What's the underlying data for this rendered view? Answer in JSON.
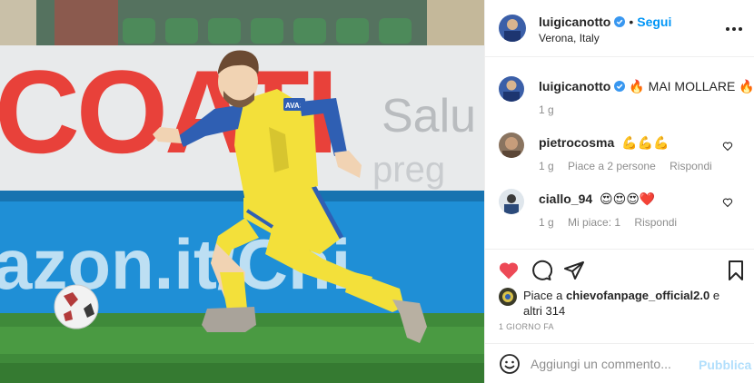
{
  "post": {
    "username": "luigicanotto",
    "follow_label": "Segui",
    "separator": "•",
    "location": "Verona, Italy",
    "caption": "MAI MOLLARE",
    "caption_emoji_before": "🔥",
    "caption_emoji_after": "🔥",
    "caption_time": "1 g"
  },
  "photo": {
    "banner_top_text": "COATI",
    "banner_top_sub": "Salu",
    "banner_top_sub2": "preg",
    "banner_bottom_text": "azon.it/Chi",
    "jersey_sponsor": "AVAST"
  },
  "comments": [
    {
      "username": "pietrocosma",
      "text": "💪💪💪",
      "time": "1 g",
      "likes": "Piace a 2 persone",
      "reply": "Rispondi"
    },
    {
      "username": "ciallo_94",
      "text": "😍😍😍❤️",
      "time": "1 g",
      "likes": "Mi piace: 1",
      "reply": "Rispondi"
    }
  ],
  "likes": {
    "prefix": "Piace a",
    "user": "chievofanpage_official2.0",
    "suffix": "e altri 314"
  },
  "posted_ago": "1 GIORNO FA",
  "add_comment": {
    "placeholder": "Aggiungi un commento...",
    "publish_label": "Pubblica"
  },
  "colors": {
    "accent": "#0095f6",
    "like_red": "#ed4956",
    "muted": "#8e8e8e",
    "jersey_yellow": "#f3e03a",
    "jersey_blue": "#2f5fb3"
  }
}
